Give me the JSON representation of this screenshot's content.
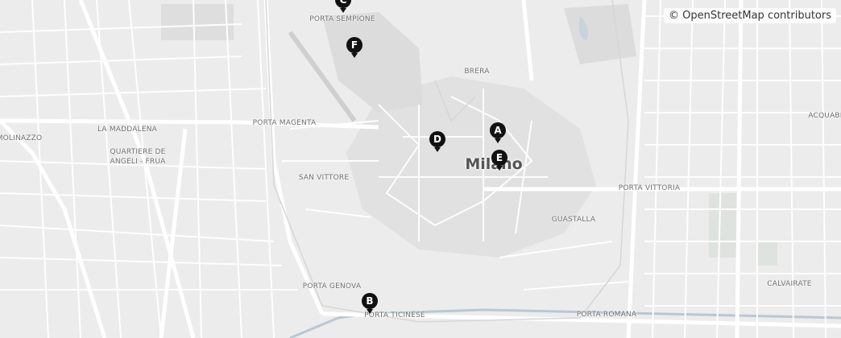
{
  "attribution": "© OpenStreetMap contributors",
  "city_label": "Milano",
  "colors": {
    "background": "#eeeeee",
    "road": "#ffffff",
    "park": "#dfe3df",
    "water": "#b9c7d4",
    "marker": "#111111"
  },
  "areas": [
    {
      "text": "PORTA SEMPIONE"
    },
    {
      "text": "BRERA"
    },
    {
      "text": "LA MADDALENA"
    },
    {
      "text": "PORTA MAGENTA"
    },
    {
      "text": "MOLINAZZO"
    },
    {
      "text": "QUARTIERE DE"
    },
    {
      "text": "ANGELI - FRUA"
    },
    {
      "text": "SAN VITTORE"
    },
    {
      "text": "PORTA VITTORIA"
    },
    {
      "text": "ACQUABE"
    },
    {
      "text": "GUASTALLA"
    },
    {
      "text": "PORTA GENOVA"
    },
    {
      "text": "PORTA TICINESE"
    },
    {
      "text": "CALVAIRATE"
    },
    {
      "text": "PORTA ROMANA"
    }
  ],
  "markers": [
    {
      "label": "A"
    },
    {
      "label": "B"
    },
    {
      "label": "C"
    },
    {
      "label": "D"
    },
    {
      "label": "E"
    },
    {
      "label": "F"
    }
  ]
}
